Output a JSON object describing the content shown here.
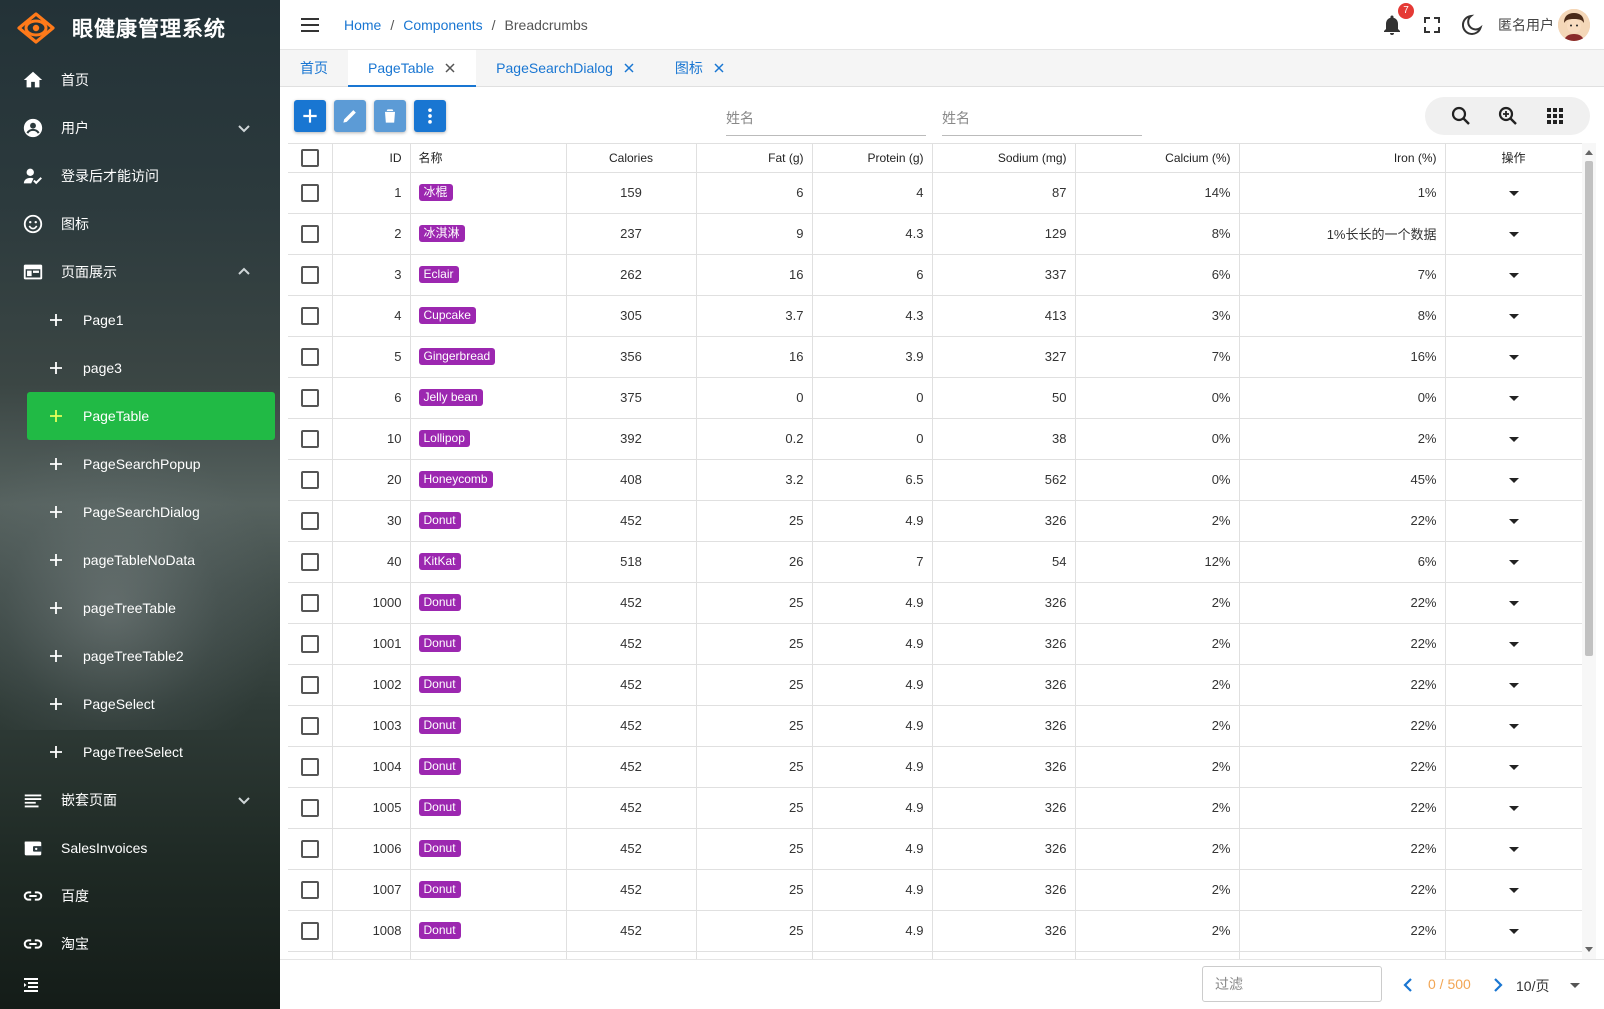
{
  "app": {
    "title": "眼健康管理系统"
  },
  "sidebar": {
    "items": [
      {
        "label": "首页",
        "icon": "home-icon",
        "expandable": false
      },
      {
        "label": "用户",
        "icon": "account-circle-icon",
        "expandable": true,
        "expanded": false
      },
      {
        "label": "登录后才能访问",
        "icon": "person-check-icon",
        "expandable": false
      },
      {
        "label": "图标",
        "icon": "smiley-icon",
        "expandable": false
      },
      {
        "label": "页面展示",
        "icon": "web-icon",
        "expandable": true,
        "expanded": true
      }
    ],
    "subitems": [
      {
        "label": "Page1"
      },
      {
        "label": "page3"
      },
      {
        "label": "PageTable",
        "active": true
      },
      {
        "label": "PageSearchPopup"
      },
      {
        "label": "PageSearchDialog"
      },
      {
        "label": "pageTableNoData"
      },
      {
        "label": "pageTreeTable"
      },
      {
        "label": "pageTreeTable2"
      },
      {
        "label": "PageSelect"
      },
      {
        "label": "PageTreeSelect"
      }
    ],
    "items_after": [
      {
        "label": "嵌套页面",
        "icon": "notes-icon",
        "expandable": true,
        "expanded": false
      },
      {
        "label": "SalesInvoices",
        "icon": "wallet-icon",
        "expandable": false
      },
      {
        "label": "百度",
        "icon": "link-icon",
        "expandable": false
      },
      {
        "label": "淘宝",
        "icon": "link-icon",
        "expandable": false
      }
    ],
    "active_color": "#21ba45"
  },
  "header": {
    "breadcrumbs": [
      "Home",
      "Components",
      "Breadcrumbs"
    ],
    "notifications": "7",
    "user_name": "匿名用户"
  },
  "tabs": [
    {
      "label": "首页",
      "closable": false,
      "active": false
    },
    {
      "label": "PageTable",
      "closable": true,
      "active": true
    },
    {
      "label": "PageSearchDialog",
      "closable": true,
      "active": false
    },
    {
      "label": "图标",
      "closable": true,
      "active": false
    }
  ],
  "toolbar": {
    "buttons": [
      "add-icon",
      "edit-icon",
      "delete-icon",
      "more-vert-icon"
    ],
    "search1_placeholder": "姓名",
    "search2_placeholder": "姓名",
    "tools": [
      "search-icon",
      "zoom-in-icon",
      "grid-icon"
    ],
    "primary_color": "#1976d2",
    "secondary_color": "#5c9bd6"
  },
  "table": {
    "columns": [
      "ID",
      "名称",
      "Calories",
      "Fat (g)",
      "Protein (g)",
      "Sodium (mg)",
      "Calcium (%)",
      "Iron (%)",
      "操作"
    ],
    "rows": [
      {
        "id": "1",
        "name": "冰棍",
        "calories": "159",
        "fat": "6",
        "protein": "4",
        "sodium": "87",
        "calcium": "14%",
        "iron": "1%"
      },
      {
        "id": "2",
        "name": "冰淇淋",
        "calories": "237",
        "fat": "9",
        "protein": "4.3",
        "sodium": "129",
        "calcium": "8%",
        "iron": "1%长长的一个数据"
      },
      {
        "id": "3",
        "name": "Eclair",
        "calories": "262",
        "fat": "16",
        "protein": "6",
        "sodium": "337",
        "calcium": "6%",
        "iron": "7%"
      },
      {
        "id": "4",
        "name": "Cupcake",
        "calories": "305",
        "fat": "3.7",
        "protein": "4.3",
        "sodium": "413",
        "calcium": "3%",
        "iron": "8%"
      },
      {
        "id": "5",
        "name": "Gingerbread",
        "calories": "356",
        "fat": "16",
        "protein": "3.9",
        "sodium": "327",
        "calcium": "7%",
        "iron": "16%"
      },
      {
        "id": "6",
        "name": "Jelly bean",
        "calories": "375",
        "fat": "0",
        "protein": "0",
        "sodium": "50",
        "calcium": "0%",
        "iron": "0%"
      },
      {
        "id": "10",
        "name": "Lollipop",
        "calories": "392",
        "fat": "0.2",
        "protein": "0",
        "sodium": "38",
        "calcium": "0%",
        "iron": "2%"
      },
      {
        "id": "20",
        "name": "Honeycomb",
        "calories": "408",
        "fat": "3.2",
        "protein": "6.5",
        "sodium": "562",
        "calcium": "0%",
        "iron": "45%"
      },
      {
        "id": "30",
        "name": "Donut",
        "calories": "452",
        "fat": "25",
        "protein": "4.9",
        "sodium": "326",
        "calcium": "2%",
        "iron": "22%"
      },
      {
        "id": "40",
        "name": "KitKat",
        "calories": "518",
        "fat": "26",
        "protein": "7",
        "sodium": "54",
        "calcium": "12%",
        "iron": "6%"
      },
      {
        "id": "1000",
        "name": "Donut",
        "calories": "452",
        "fat": "25",
        "protein": "4.9",
        "sodium": "326",
        "calcium": "2%",
        "iron": "22%"
      },
      {
        "id": "1001",
        "name": "Donut",
        "calories": "452",
        "fat": "25",
        "protein": "4.9",
        "sodium": "326",
        "calcium": "2%",
        "iron": "22%"
      },
      {
        "id": "1002",
        "name": "Donut",
        "calories": "452",
        "fat": "25",
        "protein": "4.9",
        "sodium": "326",
        "calcium": "2%",
        "iron": "22%"
      },
      {
        "id": "1003",
        "name": "Donut",
        "calories": "452",
        "fat": "25",
        "protein": "4.9",
        "sodium": "326",
        "calcium": "2%",
        "iron": "22%"
      },
      {
        "id": "1004",
        "name": "Donut",
        "calories": "452",
        "fat": "25",
        "protein": "4.9",
        "sodium": "326",
        "calcium": "2%",
        "iron": "22%"
      },
      {
        "id": "1005",
        "name": "Donut",
        "calories": "452",
        "fat": "25",
        "protein": "4.9",
        "sodium": "326",
        "calcium": "2%",
        "iron": "22%"
      },
      {
        "id": "1006",
        "name": "Donut",
        "calories": "452",
        "fat": "25",
        "protein": "4.9",
        "sodium": "326",
        "calcium": "2%",
        "iron": "22%"
      },
      {
        "id": "1007",
        "name": "Donut",
        "calories": "452",
        "fat": "25",
        "protein": "4.9",
        "sodium": "326",
        "calcium": "2%",
        "iron": "22%"
      },
      {
        "id": "1008",
        "name": "Donut",
        "calories": "452",
        "fat": "25",
        "protein": "4.9",
        "sodium": "326",
        "calcium": "2%",
        "iron": "22%"
      }
    ],
    "chip_color": "#9c27b0"
  },
  "footer": {
    "filter_placeholder": "过滤",
    "page_info": "0 / 500",
    "page_size": "10/页"
  }
}
